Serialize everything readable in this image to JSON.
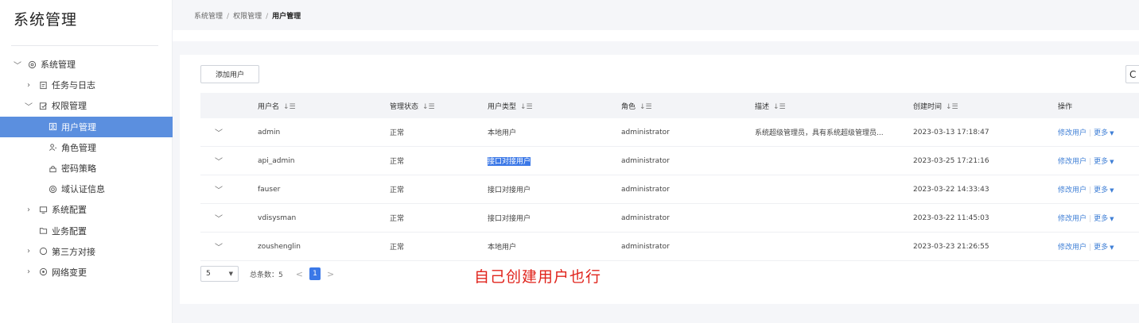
{
  "app": {
    "title": "系统管理"
  },
  "breadcrumb": {
    "items": [
      "系统管理",
      "权限管理",
      "用户管理"
    ],
    "separator": "/"
  },
  "sidebar": {
    "items": [
      {
        "label": "系统管理",
        "icon": "settings-icon",
        "chevron": "down"
      },
      {
        "label": "任务与日志",
        "icon": "document-icon",
        "chevron": "right"
      },
      {
        "label": "权限管理",
        "icon": "permission-icon",
        "chevron": "down"
      },
      {
        "label": "用户管理",
        "icon": "user-card-icon",
        "active": true
      },
      {
        "label": "角色管理",
        "icon": "role-icon"
      },
      {
        "label": "密码策略",
        "icon": "lock-icon"
      },
      {
        "label": "域认证信息",
        "icon": "domain-icon"
      },
      {
        "label": "系统配置",
        "icon": "monitor-icon",
        "chevron": "right"
      },
      {
        "label": "业务配置",
        "icon": "folder-icon"
      },
      {
        "label": "第三方对接",
        "icon": "circle-icon",
        "chevron": "right"
      },
      {
        "label": "网络变更",
        "icon": "network-icon",
        "chevron": "right"
      }
    ]
  },
  "toolbar": {
    "add_user_label": "添加用户",
    "refresh_glyph": "C"
  },
  "table": {
    "columns": [
      "用户名",
      "管理状态",
      "用户类型",
      "角色",
      "描述",
      "创建时间",
      "操作"
    ],
    "sort_glyph": "↓☰",
    "rows": [
      {
        "name": "admin",
        "state": "正常",
        "type": "本地用户",
        "role": "administrator",
        "desc": "系统超级管理员，具有系统超级管理员...",
        "time": "2023-03-13 17:18:47"
      },
      {
        "name": "api_admin",
        "state": "正常",
        "type": "接口对接用户",
        "type_selected": true,
        "role": "administrator",
        "desc": "",
        "time": "2023-03-25 17:21:16"
      },
      {
        "name": "fauser",
        "state": "正常",
        "type": "接口对接用户",
        "role": "administrator",
        "desc": "",
        "time": "2023-03-22 14:33:43"
      },
      {
        "name": "vdisysman",
        "state": "正常",
        "type": "接口对接用户",
        "role": "administrator",
        "desc": "",
        "time": "2023-03-22 11:45:03"
      },
      {
        "name": "zoushenglin",
        "state": "正常",
        "type": "本地用户",
        "role": "administrator",
        "desc": "",
        "time": "2023-03-23 21:26:55"
      }
    ],
    "ops": {
      "edit_label": "修改用户",
      "more_label": "更多"
    }
  },
  "pagination": {
    "page_size": "5",
    "total_label": "总条数：5",
    "current_page": "1",
    "prev_glyph": "<",
    "next_glyph": ">"
  },
  "annotation": {
    "text": "自己创建用户也行"
  },
  "colors": {
    "accent": "#3b78e7",
    "active_nav": "#5b8fdf",
    "link": "#3f7fd6",
    "annotation": "#e0231b"
  }
}
